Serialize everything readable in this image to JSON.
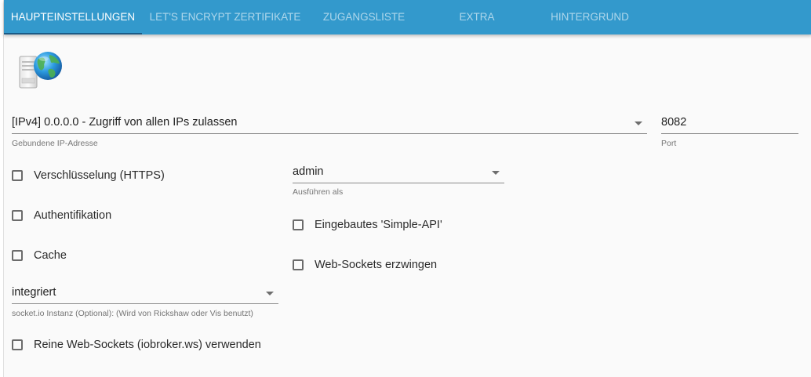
{
  "tabs": [
    {
      "label": "Haupteinstellungen",
      "active": true
    },
    {
      "label": "Let's Encrypt Zertifikate",
      "active": false
    },
    {
      "label": "Zugangsliste",
      "active": false
    },
    {
      "label": "Extra",
      "active": false
    },
    {
      "label": "Hintergrund",
      "active": false
    }
  ],
  "logo": {
    "icon": "web-server-globe-icon"
  },
  "ip_select": {
    "value": "[IPv4] 0.0.0.0 - Zugriff von allen IPs zulassen",
    "helper": "Gebundene IP-Adresse"
  },
  "port_field": {
    "value": "8082",
    "helper": "Port"
  },
  "run_as_select": {
    "value": "admin",
    "helper": "Ausführen als"
  },
  "socketio_select": {
    "value": "integriert",
    "helper": "socket.io Instanz (Optional): (Wird von Rickshaw oder Vis benutzt)"
  },
  "checkboxes": {
    "https": {
      "label": "Verschlüsselung (HTTPS)",
      "checked": false
    },
    "auth": {
      "label": "Authentifikation",
      "checked": false
    },
    "cache": {
      "label": "Cache",
      "checked": false
    },
    "simple_api": {
      "label": "Eingebautes 'Simple-API'",
      "checked": false
    },
    "force_websockets": {
      "label": "Web-Sockets erzwingen",
      "checked": false
    },
    "pure_websockets": {
      "label": "Reine Web-Sockets (iobroker.ws) verwenden",
      "checked": false
    }
  },
  "colors": {
    "tabbar": "#3399cc",
    "tab_indicator": "#1a5a86",
    "background": "#fafafa"
  }
}
